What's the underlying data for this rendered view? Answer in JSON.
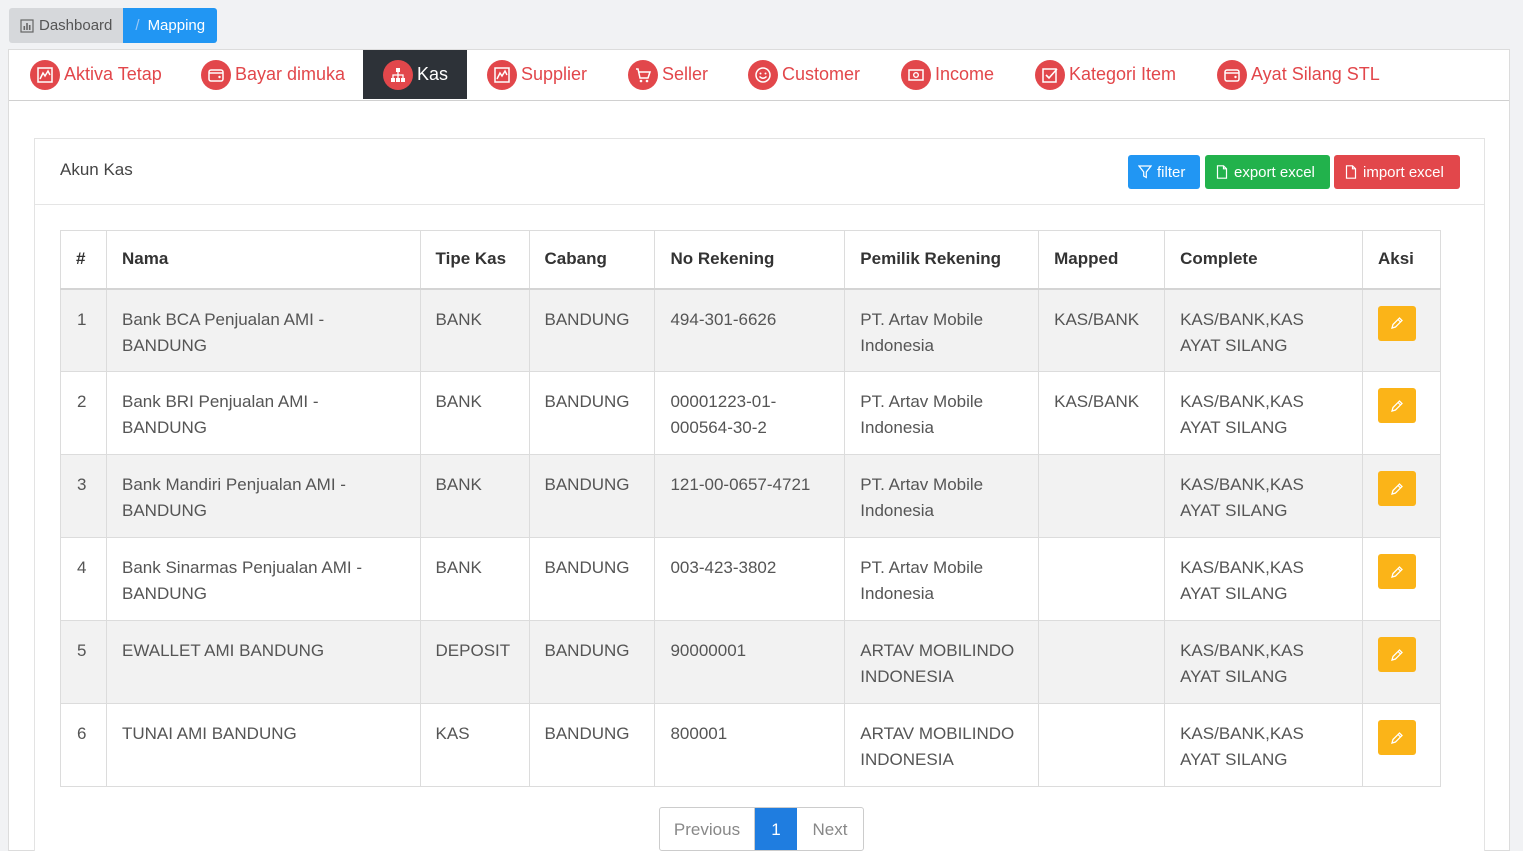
{
  "breadcrumb": {
    "home": "Dashboard",
    "separator": "/",
    "current": "Mapping"
  },
  "tabs": [
    {
      "label": "Aktiva Tetap",
      "icon": "chart-icon"
    },
    {
      "label": "Bayar dimuka",
      "icon": "wallet-icon"
    },
    {
      "label": "Kas",
      "icon": "sitemap-icon",
      "active": true
    },
    {
      "label": "Supplier",
      "icon": "chart-icon"
    },
    {
      "label": "Seller",
      "icon": "cart-icon"
    },
    {
      "label": "Customer",
      "icon": "smile-icon"
    },
    {
      "label": "Income",
      "icon": "money-icon"
    },
    {
      "label": "Kategori Item",
      "icon": "check-square-icon"
    },
    {
      "label": "Ayat Silang STL",
      "icon": "wallet-icon"
    }
  ],
  "panel": {
    "title": "Akun Kas",
    "filter_label": "filter",
    "export_label": "export excel",
    "import_label": "import excel"
  },
  "table": {
    "headers": [
      "#",
      "Nama",
      "Tipe Kas",
      "Cabang",
      "No Rekening",
      "Pemilik Rekening",
      "Mapped",
      "Complete",
      "Aksi"
    ],
    "rows": [
      {
        "no": "1",
        "nama": "Bank BCA Penjualan AMI - BANDUNG",
        "tipe": "BANK",
        "cabang": "BANDUNG",
        "rek": "494-301-6626",
        "pemilik": "PT. Artav Mobile Indonesia",
        "mapped": "KAS/BANK",
        "complete": "KAS/BANK,KAS AYAT SILANG"
      },
      {
        "no": "2",
        "nama": "Bank BRI Penjualan AMI - BANDUNG",
        "tipe": "BANK",
        "cabang": "BANDUNG",
        "rek": "00001223-01-000564-30-2",
        "pemilik": "PT. Artav Mobile Indonesia",
        "mapped": "KAS/BANK",
        "complete": "KAS/BANK,KAS AYAT SILANG"
      },
      {
        "no": "3",
        "nama": "Bank Mandiri Penjualan AMI - BANDUNG",
        "tipe": "BANK",
        "cabang": "BANDUNG",
        "rek": "121-00-0657-4721",
        "pemilik": "PT. Artav Mobile Indonesia",
        "mapped": "",
        "complete": "KAS/BANK,KAS AYAT SILANG"
      },
      {
        "no": "4",
        "nama": "Bank Sinarmas Penjualan AMI - BANDUNG",
        "tipe": "BANK",
        "cabang": "BANDUNG",
        "rek": "003-423-3802",
        "pemilik": "PT. Artav Mobile Indonesia",
        "mapped": "",
        "complete": "KAS/BANK,KAS AYAT SILANG"
      },
      {
        "no": "5",
        "nama": "EWALLET AMI BANDUNG",
        "tipe": "DEPOSIT",
        "cabang": "BANDUNG",
        "rek": "90000001",
        "pemilik": "ARTAV MOBILINDO INDONESIA",
        "mapped": "",
        "complete": "KAS/BANK,KAS AYAT SILANG"
      },
      {
        "no": "6",
        "nama": "TUNAI AMI BANDUNG",
        "tipe": "KAS",
        "cabang": "BANDUNG",
        "rek": "800001",
        "pemilik": "ARTAV MOBILINDO INDONESIA",
        "mapped": "",
        "complete": "KAS/BANK,KAS AYAT SILANG"
      }
    ]
  },
  "pagination": {
    "previous": "Previous",
    "current": "1",
    "next": "Next"
  },
  "colors": {
    "primary": "#2196f3",
    "success": "#22b24c",
    "danger": "#e2474b",
    "warning": "#fbb418",
    "tab_active": "#2d3238"
  }
}
